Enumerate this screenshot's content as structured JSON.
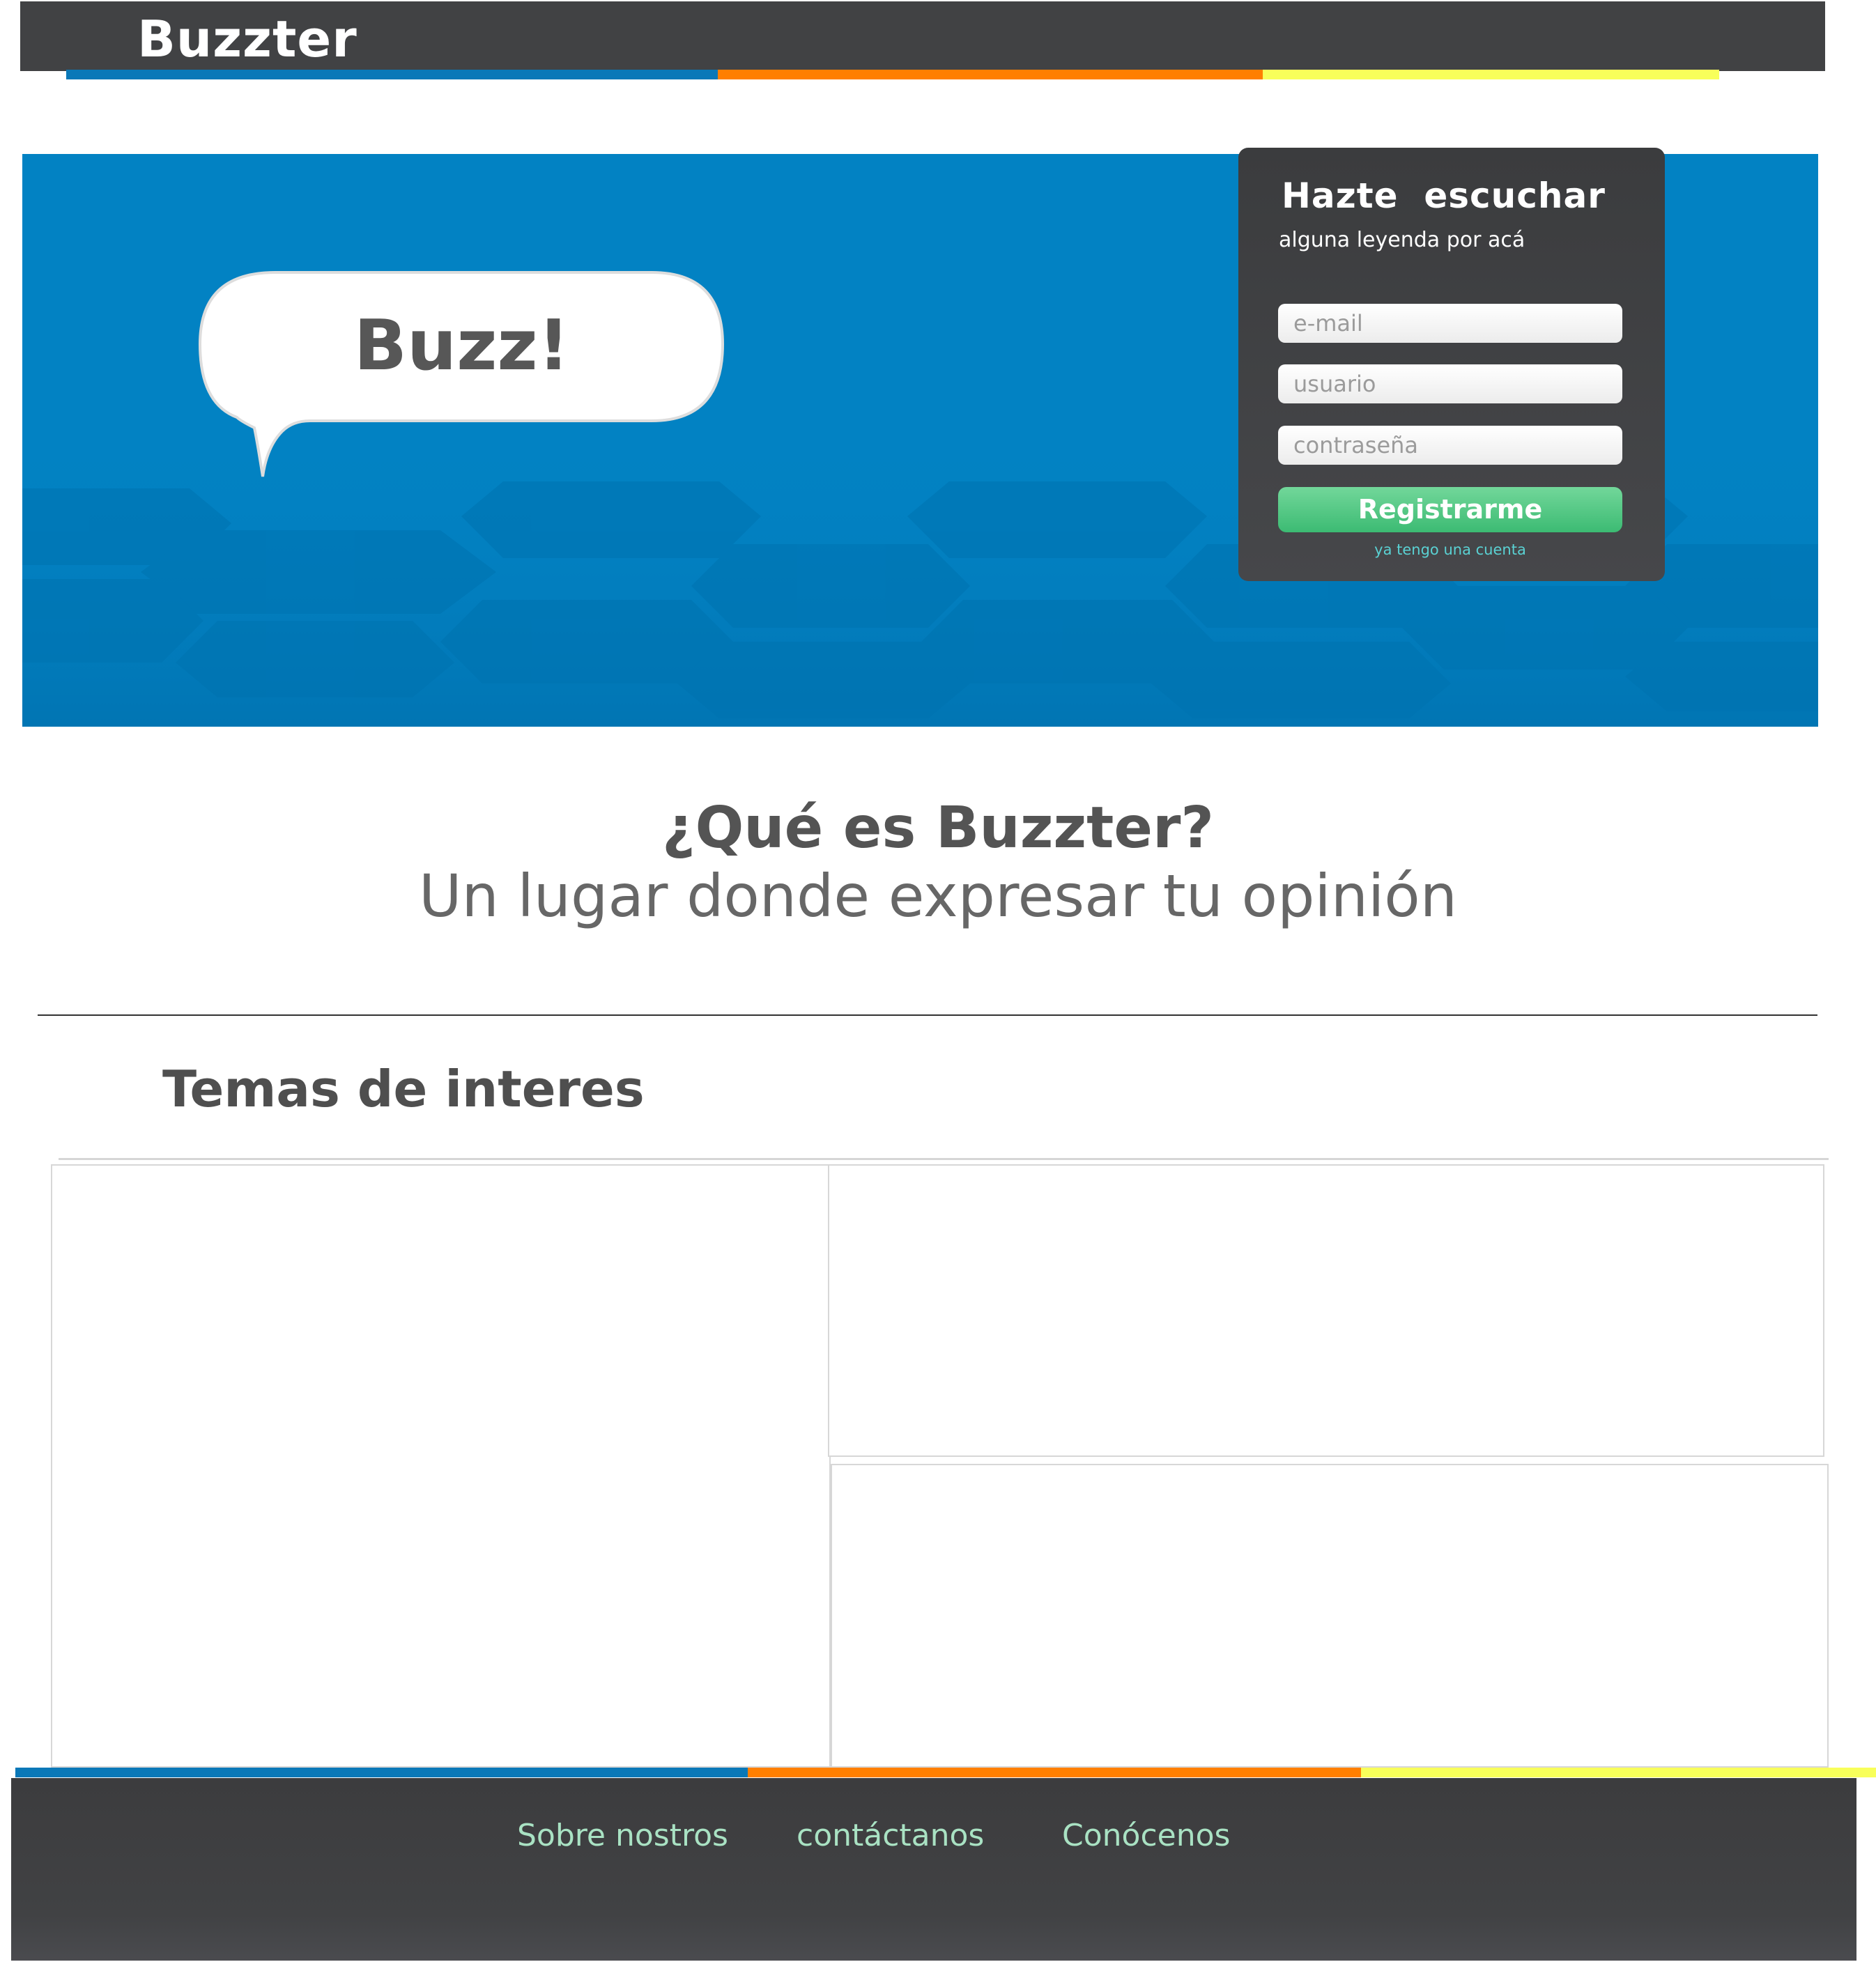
{
  "header": {
    "logo": "Buzzter"
  },
  "colors": {
    "bar_dark": "#414244",
    "stripe_blue": "#0a78b8",
    "stripe_orange": "#ff7f00",
    "stripe_yellow": "#f8ff5a",
    "hero_blue": "#0282c3",
    "register_green": "#4dc784",
    "footer_link": "#a9e2c3"
  },
  "hero": {
    "bubble_text": "Buzz!"
  },
  "signup": {
    "title": "Hazte  escuchar",
    "subtitle": "alguna leyenda por acá",
    "email_placeholder": "e-mail",
    "user_placeholder": "usuario",
    "password_placeholder": "contraseña",
    "submit_label": "Registrarme",
    "login_link": "ya tengo una cuenta"
  },
  "intro": {
    "title": "¿Qué es Buzzter?",
    "subtitle": "Un lugar donde expresar tu opinión"
  },
  "topics": {
    "title": "Temas de interes"
  },
  "footer": {
    "links": [
      "Sobre nostros",
      "contáctanos",
      "Conócenos"
    ]
  }
}
